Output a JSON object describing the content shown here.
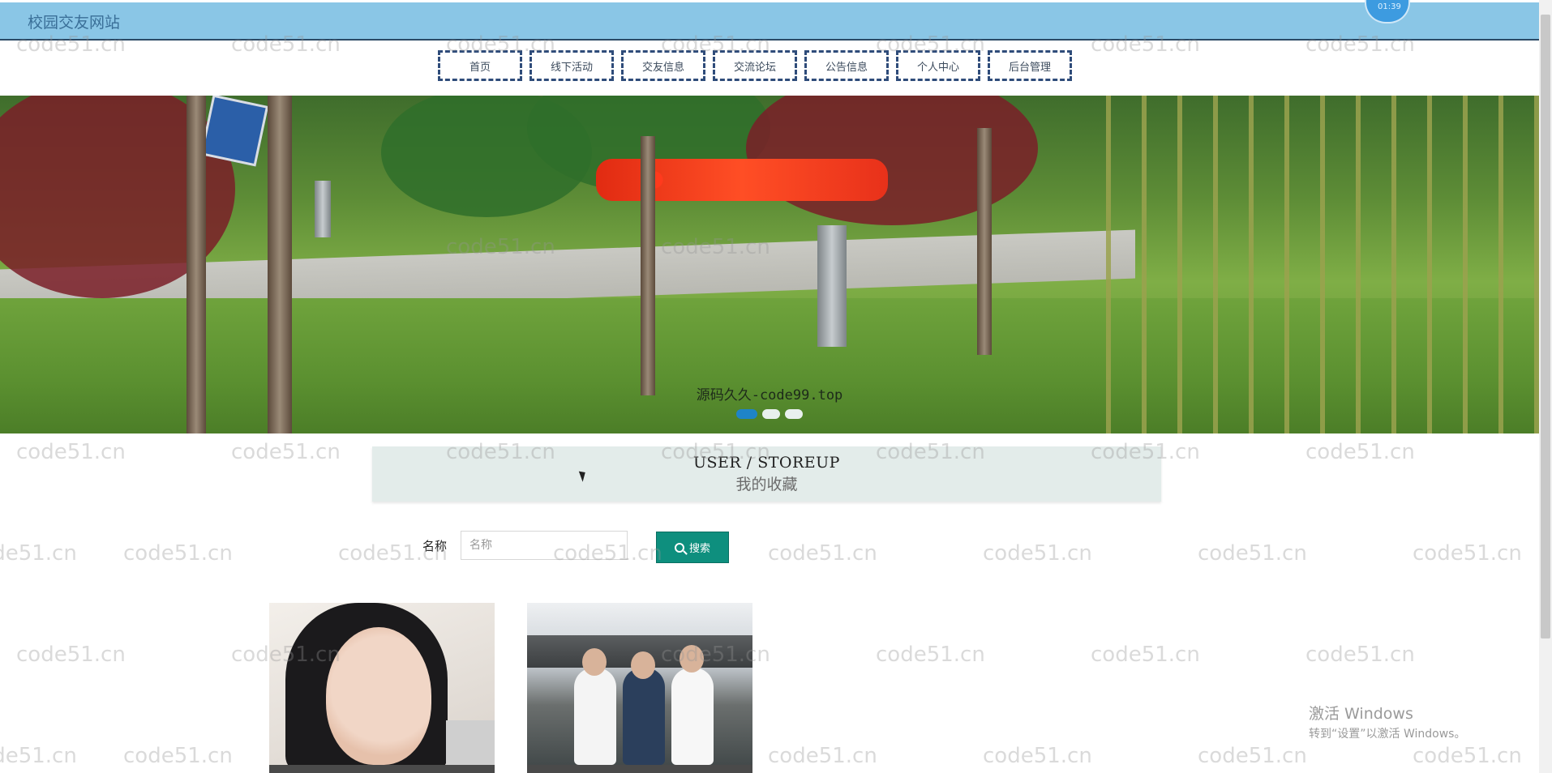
{
  "header": {
    "site_title": "校园交友网站",
    "clock_text": "01:39"
  },
  "nav": {
    "items": [
      {
        "label": "首页"
      },
      {
        "label": "线下活动"
      },
      {
        "label": "交友信息"
      },
      {
        "label": "交流论坛"
      },
      {
        "label": "公告信息"
      },
      {
        "label": "个人中心"
      },
      {
        "label": "后台管理"
      }
    ]
  },
  "banner": {
    "caption": "源码久久-code99.top",
    "slide_count": 3,
    "active_slide": 1,
    "colors": {
      "active_dot": "#1e84c8",
      "dot": "#e9f0ee"
    }
  },
  "section": {
    "title_en": "USER / STOREUP",
    "title_cn": "我的收藏"
  },
  "search": {
    "label": "名称",
    "placeholder": "名称",
    "value": "",
    "button_label": "搜索",
    "button_color": "#0e8f7e"
  },
  "cards": [
    {
      "image": "portrait-photo"
    },
    {
      "image": "group-photo"
    }
  ],
  "watermark": "code51.cn",
  "windows_activation": {
    "line1": "激活 Windows",
    "line2": "转到“设置”以激活 Windows。"
  }
}
